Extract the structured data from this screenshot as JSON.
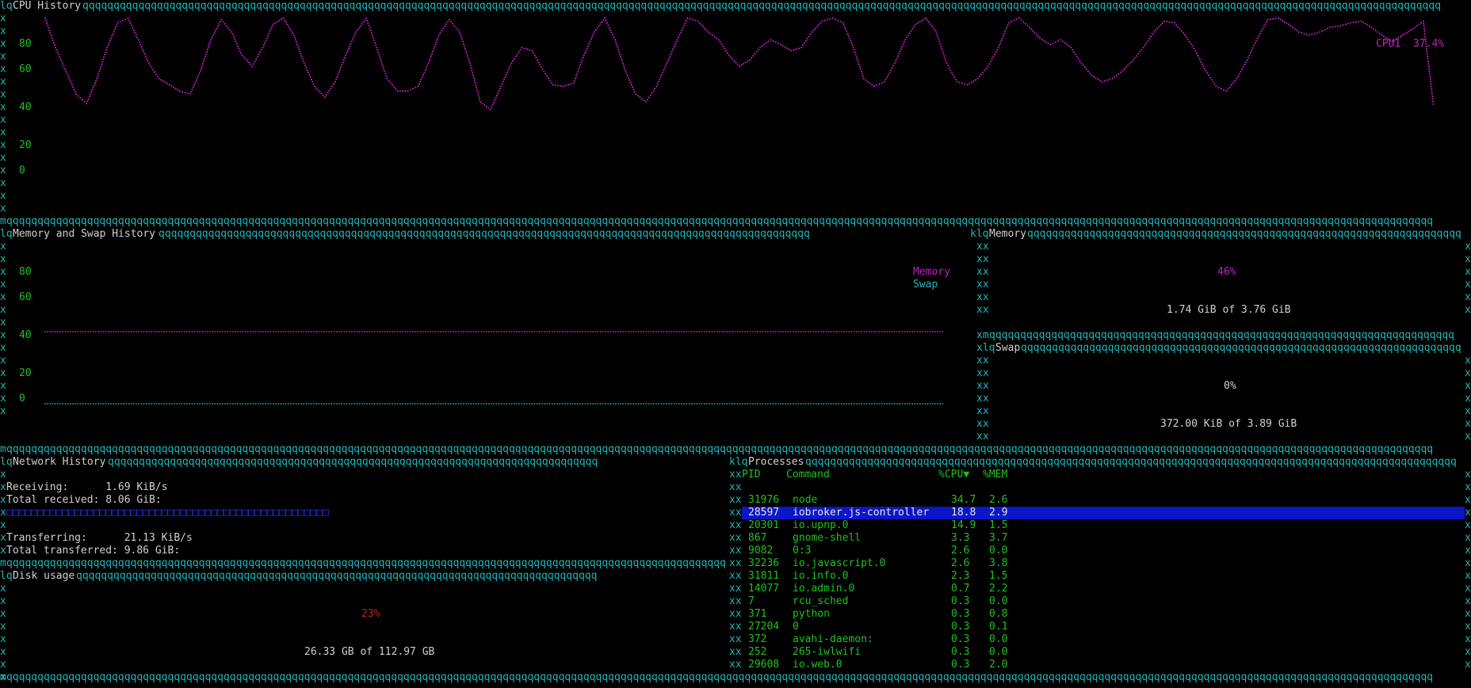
{
  "cpu": {
    "title": "CPU History",
    "ticks": [
      "80",
      "60",
      "40",
      "20",
      "0"
    ],
    "legend": "CPU1  37.4%",
    "color": "#c41fc4",
    "samples": [
      99,
      80,
      65,
      50,
      44,
      60,
      80,
      96,
      99,
      85,
      70,
      60,
      56,
      52,
      50,
      65,
      85,
      98,
      90,
      75,
      68,
      80,
      95,
      99,
      88,
      70,
      55,
      48,
      58,
      75,
      90,
      99,
      80,
      60,
      52,
      52,
      55,
      70,
      88,
      98,
      90,
      70,
      45,
      40,
      55,
      70,
      80,
      78,
      66,
      56,
      55,
      57,
      75,
      90,
      99,
      85,
      65,
      50,
      45,
      55,
      70,
      85,
      99,
      97,
      90,
      85,
      75,
      68,
      72,
      80,
      85,
      82,
      78,
      80,
      90,
      97,
      99,
      96,
      80,
      60,
      55,
      58,
      70,
      85,
      95,
      99,
      90,
      70,
      58,
      56,
      60,
      68,
      80,
      96,
      99,
      93,
      86,
      82,
      85,
      80,
      70,
      62,
      58,
      60,
      65,
      72,
      80,
      90,
      97,
      96,
      88,
      78,
      65,
      55,
      52,
      60,
      72,
      86,
      98,
      99,
      95,
      90,
      88,
      90,
      93,
      94,
      96,
      97,
      93,
      88,
      84,
      88,
      92,
      97,
      42
    ]
  },
  "memory_history": {
    "title": "Memory and Swap History",
    "ticks": [
      "80",
      "60",
      "40",
      "20",
      "0"
    ],
    "legend": [
      "Memory",
      "Swap"
    ],
    "memory_percent": 46,
    "swap_percent": 0,
    "memory_color": "#c41fc4",
    "swap_color": "#22b5b5"
  },
  "memory": {
    "title": "Memory",
    "percent_label": "46%",
    "detail": "1.74 GiB of 3.76 GiB"
  },
  "swap": {
    "title": "Swap",
    "percent_label": "0%",
    "detail": "372.00 KiB of 3.89 GiB"
  },
  "network": {
    "title": "Network History",
    "receiving": "Receiving:      1.69 KiB/s",
    "total_received": "Total received: 8.06 GiB:",
    "transferring": "Transferring:      21.13 KiB/s",
    "total_transferred": "Total transferred: 9.86 GiB:"
  },
  "disk": {
    "title": "Disk usage",
    "percent_label": "23%",
    "detail": "26.33 GB of 112.97 GB"
  },
  "processes": {
    "title": "Processes",
    "columns": {
      "pid": "PID",
      "command": "Command",
      "cpu": "%CPU▼",
      "mem": "%MEM"
    },
    "selected_index": 1,
    "rows": [
      {
        "pid": "31976",
        "command": "node",
        "cpu": "34.7",
        "mem": "2.6"
      },
      {
        "pid": "28597",
        "command": "iobroker.js-controller",
        "cpu": "18.8",
        "mem": "2.9"
      },
      {
        "pid": "20301",
        "command": "io.upnp.0",
        "cpu": "14.9",
        "mem": "1.5"
      },
      {
        "pid": "867",
        "command": "gnome-shell",
        "cpu": "3.3",
        "mem": "3.7"
      },
      {
        "pid": "9082",
        "command": "0:3",
        "cpu": "2.6",
        "mem": "0.0"
      },
      {
        "pid": "32236",
        "command": "io.javascript.0",
        "cpu": "2.6",
        "mem": "3.8"
      },
      {
        "pid": "31811",
        "command": "io.info.0",
        "cpu": "2.3",
        "mem": "1.5"
      },
      {
        "pid": "14077",
        "command": "io.admin.0",
        "cpu": "0.7",
        "mem": "2.2"
      },
      {
        "pid": "7",
        "command": "rcu_sched",
        "cpu": "0.3",
        "mem": "0.0"
      },
      {
        "pid": "371",
        "command": "python",
        "cpu": "0.3",
        "mem": "0.8"
      },
      {
        "pid": "27204",
        "command": "0",
        "cpu": "0.3",
        "mem": "0.1"
      },
      {
        "pid": "372",
        "command": "avahi-daemon:",
        "cpu": "0.3",
        "mem": "0.0"
      },
      {
        "pid": "252",
        "command": "265-iwlwifi",
        "cpu": "0.3",
        "mem": "0.0"
      },
      {
        "pid": "29608",
        "command": "io.web.0",
        "cpu": "0.3",
        "mem": "2.0"
      }
    ]
  }
}
